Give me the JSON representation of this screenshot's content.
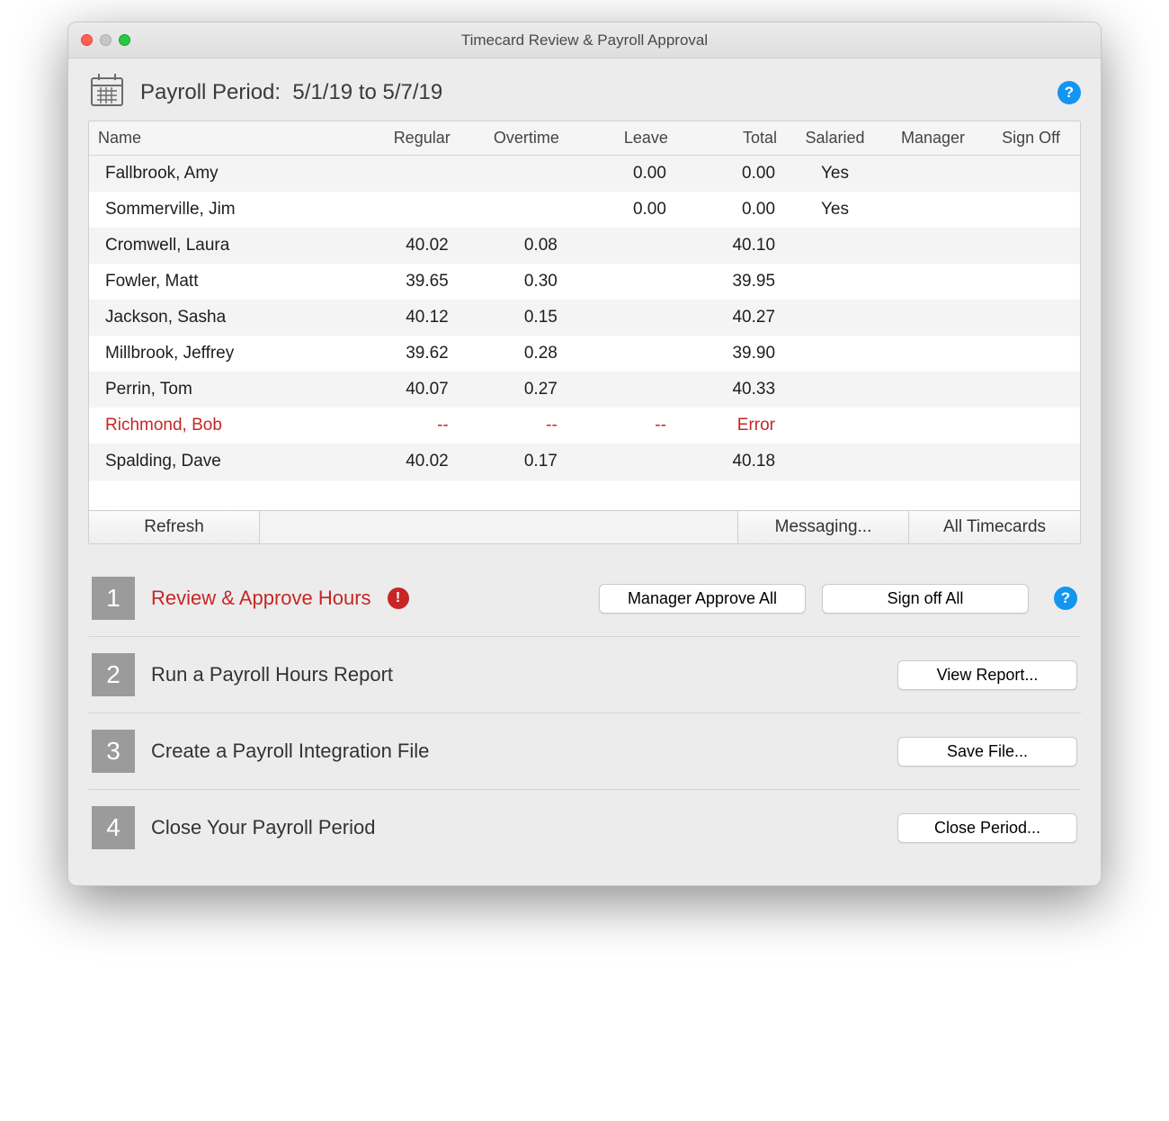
{
  "window": {
    "title": "Timecard Review & Payroll Approval"
  },
  "period": {
    "label": "Payroll Period:",
    "range": "5/1/19 to 5/7/19"
  },
  "columns": {
    "name": "Name",
    "regular": "Regular",
    "overtime": "Overtime",
    "leave": "Leave",
    "total": "Total",
    "salaried": "Salaried",
    "manager": "Manager",
    "signoff": "Sign Off"
  },
  "rows": [
    {
      "name": "Fallbrook, Amy",
      "regular": "",
      "overtime": "",
      "leave": "0.00",
      "total": "0.00",
      "salaried": "Yes",
      "error": false
    },
    {
      "name": "Sommerville, Jim",
      "regular": "",
      "overtime": "",
      "leave": "0.00",
      "total": "0.00",
      "salaried": "Yes",
      "error": false
    },
    {
      "name": "Cromwell, Laura",
      "regular": "40.02",
      "overtime": "0.08",
      "leave": "",
      "total": "40.10",
      "salaried": "",
      "error": false
    },
    {
      "name": "Fowler, Matt",
      "regular": "39.65",
      "overtime": "0.30",
      "leave": "",
      "total": "39.95",
      "salaried": "",
      "error": false
    },
    {
      "name": "Jackson, Sasha",
      "regular": "40.12",
      "overtime": "0.15",
      "leave": "",
      "total": "40.27",
      "salaried": "",
      "error": false
    },
    {
      "name": "Millbrook, Jeffrey",
      "regular": "39.62",
      "overtime": "0.28",
      "leave": "",
      "total": "39.90",
      "salaried": "",
      "error": false
    },
    {
      "name": "Perrin, Tom",
      "regular": "40.07",
      "overtime": "0.27",
      "leave": "",
      "total": "40.33",
      "salaried": "",
      "error": false
    },
    {
      "name": "Richmond, Bob",
      "regular": "--",
      "overtime": "--",
      "leave": "--",
      "total": "Error",
      "salaried": "",
      "error": true
    },
    {
      "name": "Spalding, Dave",
      "regular": "40.02",
      "overtime": "0.17",
      "leave": "",
      "total": "40.18",
      "salaried": "",
      "error": false
    }
  ],
  "toolbar": {
    "refresh": "Refresh",
    "messaging": "Messaging...",
    "all_timecards": "All Timecards"
  },
  "steps": [
    {
      "num": "1",
      "label": "Review & Approve Hours",
      "alert": true,
      "buttons": [
        "Manager Approve All",
        "Sign off All"
      ],
      "help": true
    },
    {
      "num": "2",
      "label": "Run a Payroll Hours Report",
      "alert": false,
      "buttons": [
        "View Report..."
      ],
      "help": false
    },
    {
      "num": "3",
      "label": "Create a Payroll Integration File",
      "alert": false,
      "buttons": [
        "Save File..."
      ],
      "help": false
    },
    {
      "num": "4",
      "label": "Close Your Payroll Period",
      "alert": false,
      "buttons": [
        "Close Period..."
      ],
      "help": false
    }
  ]
}
